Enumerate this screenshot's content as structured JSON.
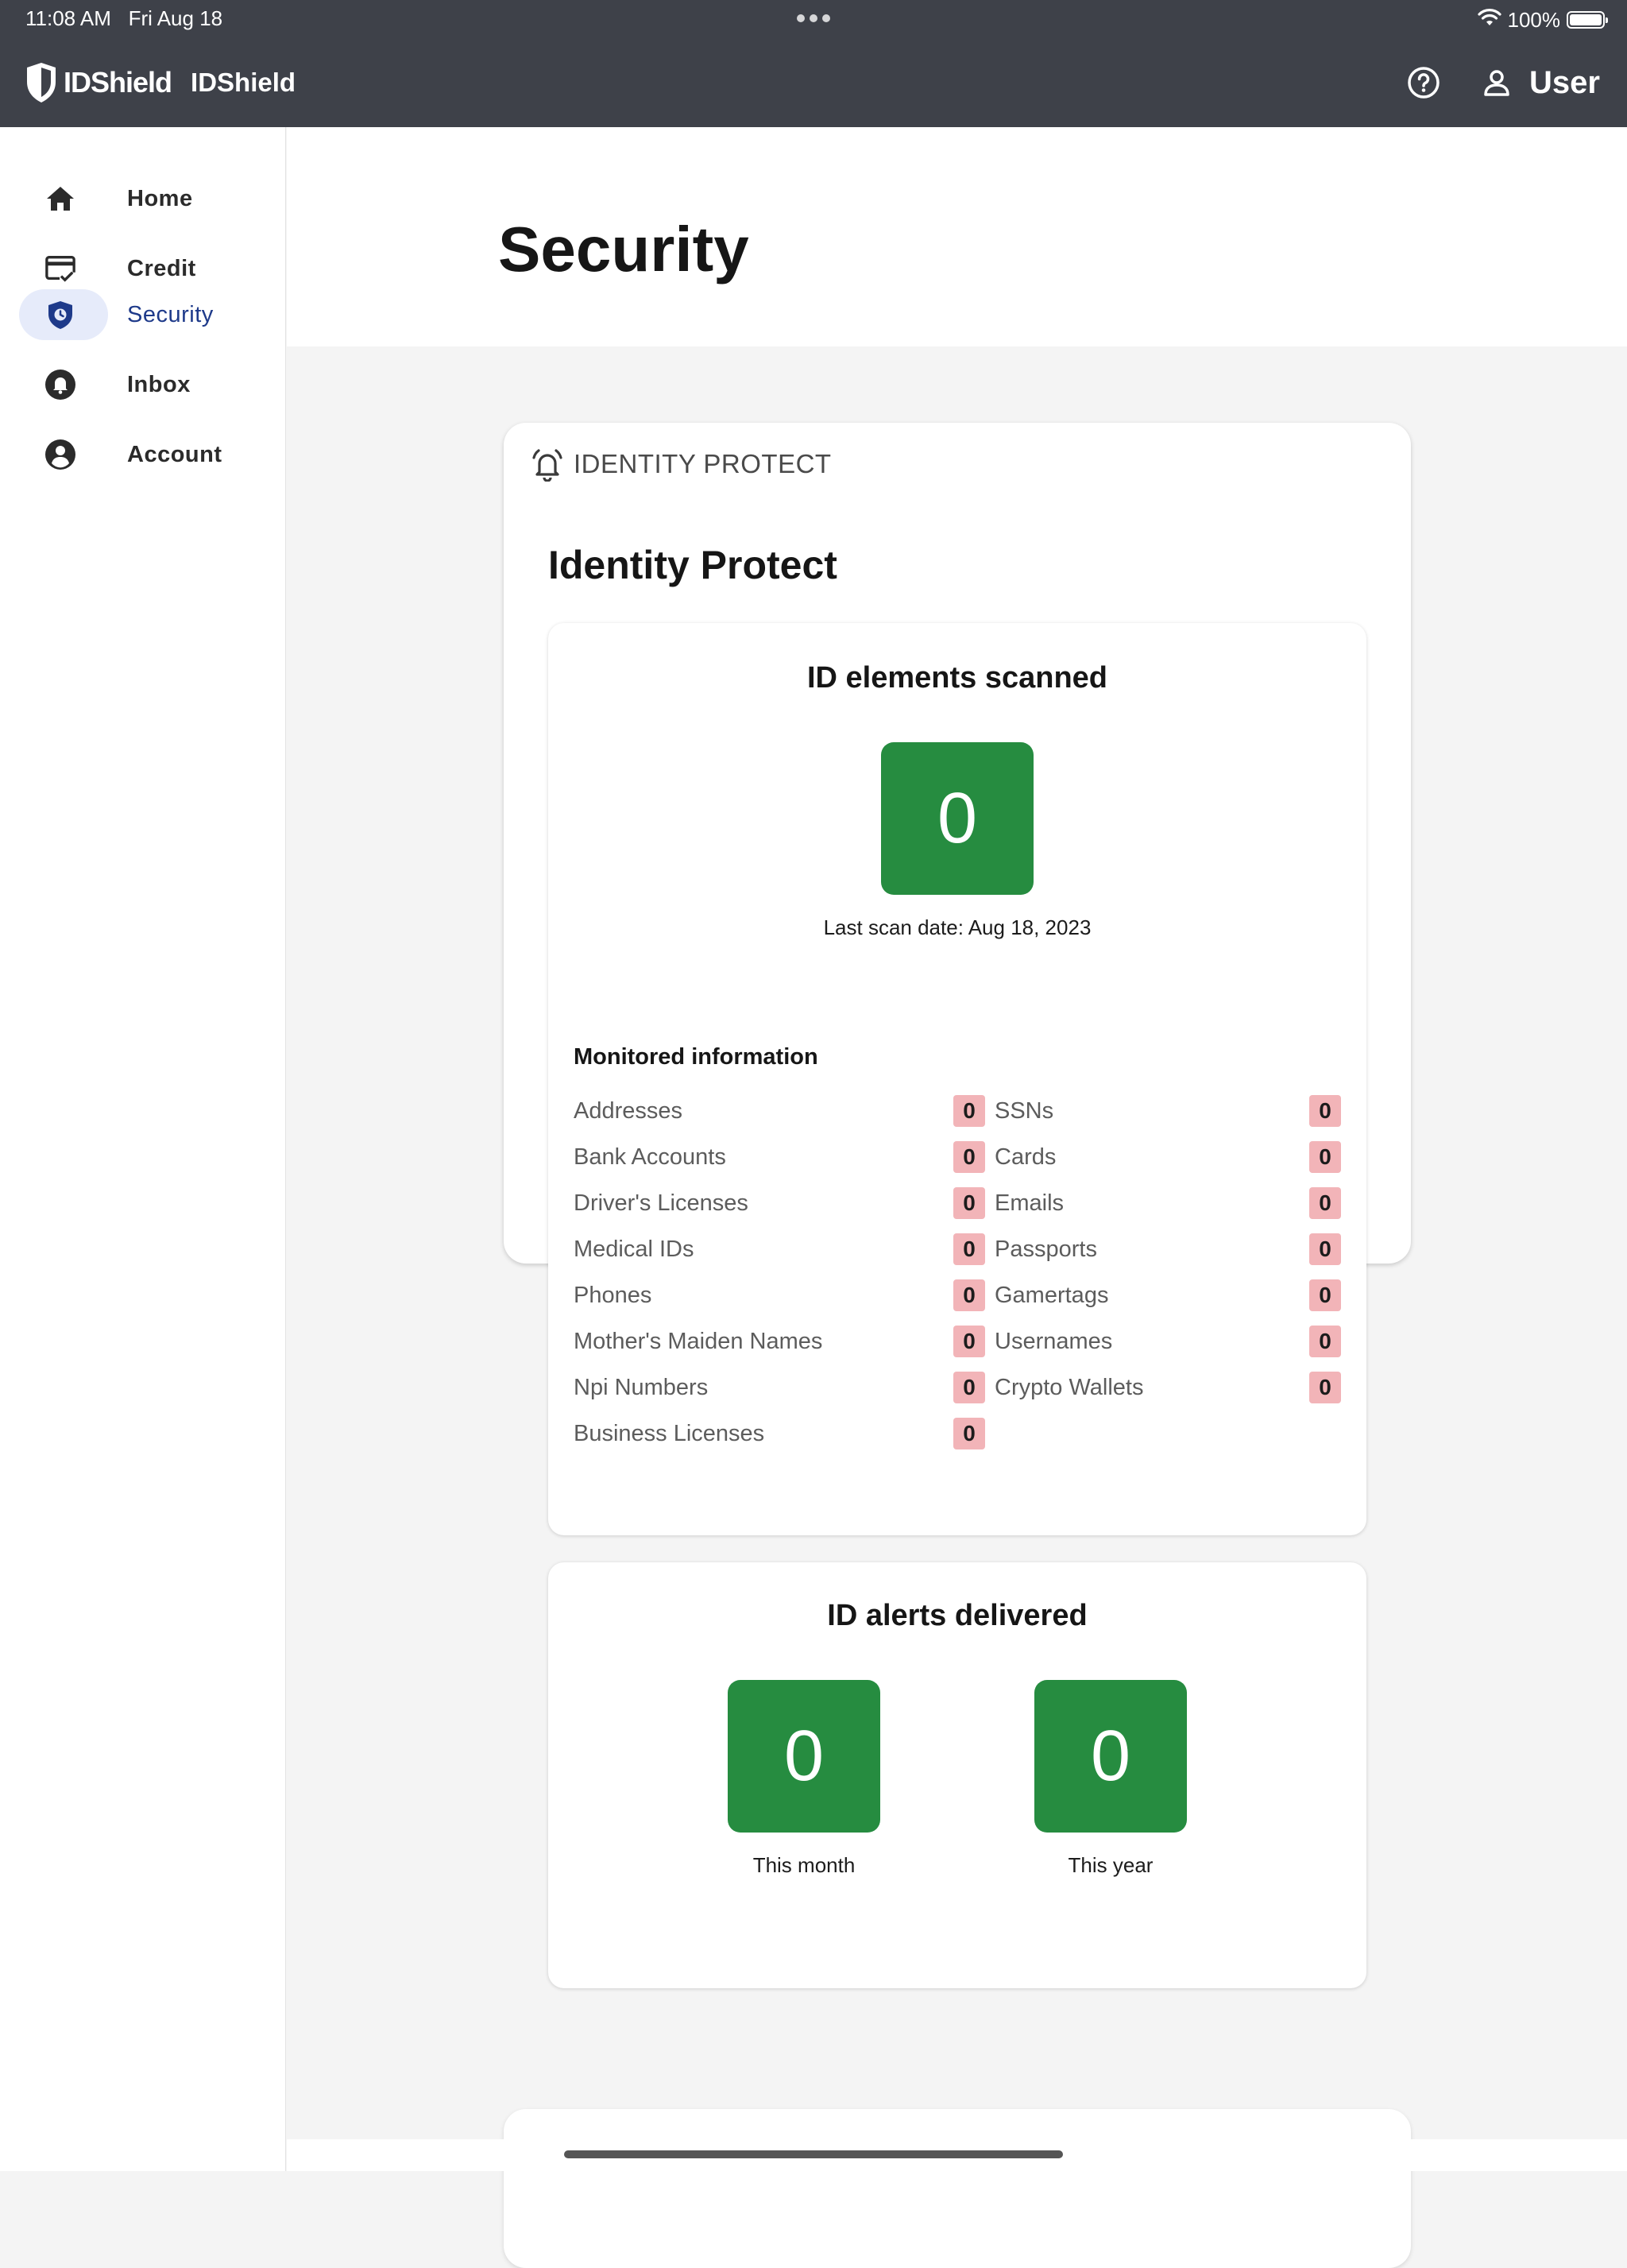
{
  "status_bar": {
    "time": "11:08 AM",
    "date": "Fri Aug 18",
    "battery": "100%"
  },
  "header": {
    "logo_text": "IDShield",
    "app_name": "IDShield",
    "user_label": "User"
  },
  "sidebar": {
    "items": [
      {
        "label": "Home",
        "icon": "home-icon",
        "active": false
      },
      {
        "label": "Credit",
        "icon": "credit-card-check-icon",
        "active": false
      },
      {
        "label": "Security",
        "icon": "shield-clock-icon",
        "active": true
      },
      {
        "label": "Inbox",
        "icon": "bell-icon",
        "active": false
      },
      {
        "label": "Account",
        "icon": "account-circle-icon",
        "active": false
      }
    ]
  },
  "page": {
    "title": "Security"
  },
  "identity_protect": {
    "section_label": "IDENTITY PROTECT",
    "title": "Identity Protect",
    "scanned": {
      "heading": "ID elements scanned",
      "count": "0",
      "last_scan": "Last scan date: Aug 18, 2023"
    },
    "monitored": {
      "title": "Monitored information",
      "left": [
        {
          "label": "Addresses",
          "count": "0"
        },
        {
          "label": "Bank Accounts",
          "count": "0"
        },
        {
          "label": "Driver's Licenses",
          "count": "0"
        },
        {
          "label": "Medical IDs",
          "count": "0"
        },
        {
          "label": "Phones",
          "count": "0"
        },
        {
          "label": "Mother's Maiden Names",
          "count": "0"
        },
        {
          "label": "Npi Numbers",
          "count": "0"
        },
        {
          "label": "Business Licenses",
          "count": "0"
        }
      ],
      "right": [
        {
          "label": "SSNs",
          "count": "0"
        },
        {
          "label": "Cards",
          "count": "0"
        },
        {
          "label": "Emails",
          "count": "0"
        },
        {
          "label": "Passports",
          "count": "0"
        },
        {
          "label": "Gamertags",
          "count": "0"
        },
        {
          "label": "Usernames",
          "count": "0"
        },
        {
          "label": "Crypto Wallets",
          "count": "0"
        }
      ]
    },
    "alerts": {
      "heading": "ID alerts delivered",
      "month_count": "0",
      "month_label": "This month",
      "year_count": "0",
      "year_label": "This year"
    }
  },
  "colors": {
    "topbar": "#3e4149",
    "accent": "#1e3a8a",
    "active_pill": "#e6ebfa",
    "count_green": "#268c40",
    "badge_pink": "#f2b4b8"
  }
}
